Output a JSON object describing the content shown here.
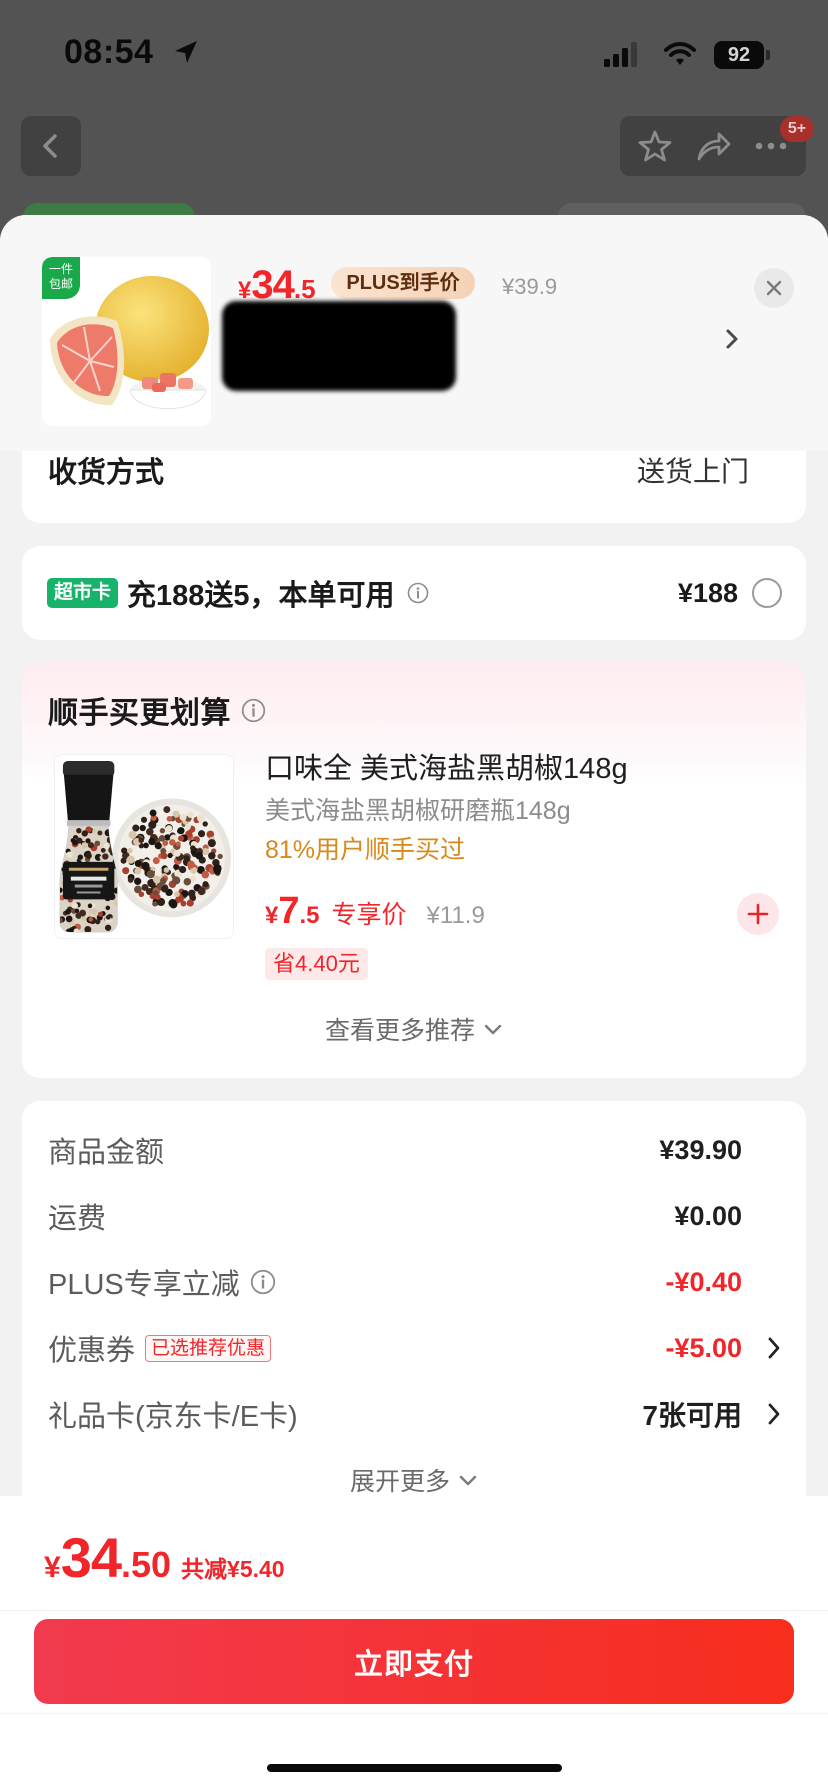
{
  "status_bar": {
    "time": "08:54",
    "battery": "92"
  },
  "nav": {
    "more_badge": "5+"
  },
  "product": {
    "free_shipping_badge": [
      "一件",
      "包邮"
    ],
    "price": {
      "currency": "¥",
      "integer": "34",
      "decimal": ".5"
    },
    "plus_label": "PLUS到手价",
    "original_price": "¥39.9"
  },
  "delivery": {
    "label": "收货方式",
    "value": "送货上门"
  },
  "store_card": {
    "badge": "超市卡",
    "text": "充188送5，本单可用",
    "amount": "¥188",
    "selected": false
  },
  "add_on": {
    "title": "顺手买更划算",
    "item": {
      "name": "口味全 美式海盐黑胡椒148g",
      "spec": "美式海盐黑胡椒研磨瓶148g",
      "social_proof": "81%用户顺手买过",
      "price": {
        "currency": "¥",
        "integer": "7",
        "decimal": ".5"
      },
      "price_label": "专享价",
      "original_price": "¥11.9",
      "saving": "省4.40元"
    },
    "more": "查看更多推荐"
  },
  "summary": {
    "rows": [
      {
        "label": "商品金额",
        "value": "¥39.90"
      },
      {
        "label": "运费",
        "value": "¥0.00"
      },
      {
        "label": "PLUS专享立减",
        "value": "-¥0.40"
      },
      {
        "label": "优惠券",
        "tag": "已选推荐优惠",
        "value": "-¥5.00"
      },
      {
        "label": "礼品卡(京东卡/E卡)",
        "value": "7张可用"
      }
    ],
    "expand": "展开更多"
  },
  "footer": {
    "total": {
      "currency": "¥",
      "integer": "34",
      "decimal": ".50"
    },
    "discount": "共减¥5.40",
    "pay_button": "立即支付"
  },
  "colors": {
    "price_red": "#f0262b",
    "store_card_green": "#17b36a",
    "pay_button_gradient": [
      "#f23a4f",
      "#f72d1d"
    ]
  }
}
